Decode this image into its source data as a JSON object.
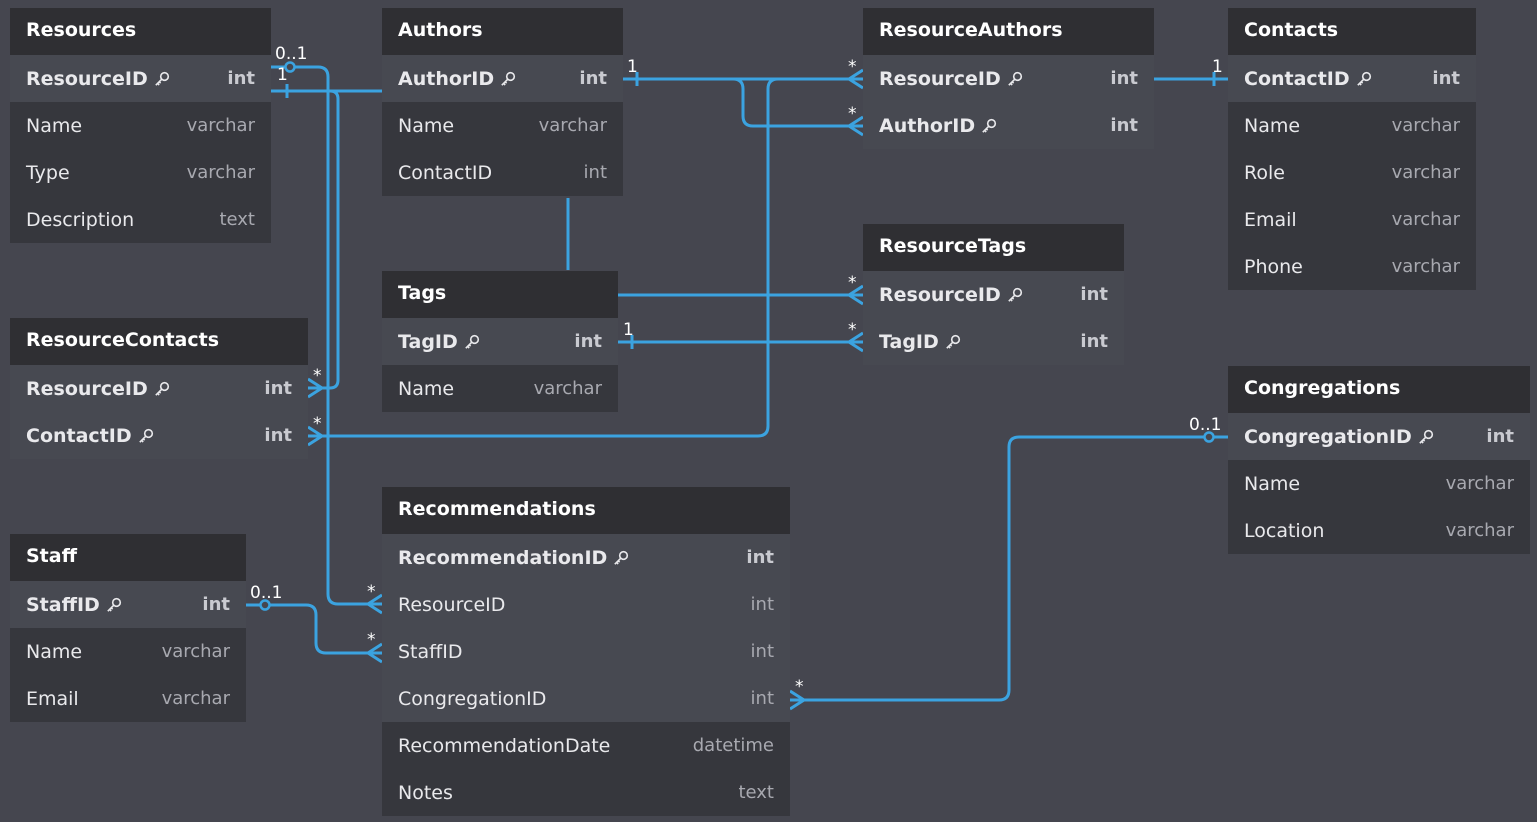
{
  "tables": [
    {
      "id": "resources",
      "title": "Resources",
      "fields": [
        {
          "name": "ResourceID",
          "type": "int",
          "pk": true
        },
        {
          "name": "Name",
          "type": "varchar"
        },
        {
          "name": "Type",
          "type": "varchar"
        },
        {
          "name": "Description",
          "type": "text"
        }
      ]
    },
    {
      "id": "authors",
      "title": "Authors",
      "fields": [
        {
          "name": "AuthorID",
          "type": "int",
          "pk": true
        },
        {
          "name": "Name",
          "type": "varchar"
        },
        {
          "name": "ContactID",
          "type": "int"
        }
      ]
    },
    {
      "id": "resourceauthors",
      "title": "ResourceAuthors",
      "fields": [
        {
          "name": "ResourceID",
          "type": "int",
          "pk": true
        },
        {
          "name": "AuthorID",
          "type": "int",
          "pk": true
        }
      ]
    },
    {
      "id": "contacts",
      "title": "Contacts",
      "fields": [
        {
          "name": "ContactID",
          "type": "int",
          "pk": true
        },
        {
          "name": "Name",
          "type": "varchar"
        },
        {
          "name": "Role",
          "type": "varchar"
        },
        {
          "name": "Email",
          "type": "varchar"
        },
        {
          "name": "Phone",
          "type": "varchar"
        }
      ]
    },
    {
      "id": "resourcetags",
      "title": "ResourceTags",
      "fields": [
        {
          "name": "ResourceID",
          "type": "int",
          "pk": true
        },
        {
          "name": "TagID",
          "type": "int",
          "pk": true
        }
      ]
    },
    {
      "id": "tags",
      "title": "Tags",
      "fields": [
        {
          "name": "TagID",
          "type": "int",
          "pk": true
        },
        {
          "name": "Name",
          "type": "varchar"
        }
      ]
    },
    {
      "id": "resourcecontacts",
      "title": "ResourceContacts",
      "fields": [
        {
          "name": "ResourceID",
          "type": "int",
          "pk": true
        },
        {
          "name": "ContactID",
          "type": "int",
          "pk": true
        }
      ]
    },
    {
      "id": "congregations",
      "title": "Congregations",
      "fields": [
        {
          "name": "CongregationID",
          "type": "int",
          "pk": true
        },
        {
          "name": "Name",
          "type": "varchar"
        },
        {
          "name": "Location",
          "type": "varchar"
        }
      ]
    },
    {
      "id": "staff",
      "title": "Staff",
      "fields": [
        {
          "name": "StaffID",
          "type": "int",
          "pk": true
        },
        {
          "name": "Name",
          "type": "varchar"
        },
        {
          "name": "Email",
          "type": "varchar"
        }
      ]
    },
    {
      "id": "recommendations",
      "title": "Recommendations",
      "fields": [
        {
          "name": "RecommendationID",
          "type": "int",
          "pk": true
        },
        {
          "name": "ResourceID",
          "type": "int",
          "fk": true
        },
        {
          "name": "StaffID",
          "type": "int",
          "fk": true
        },
        {
          "name": "CongregationID",
          "type": "int",
          "fk": true
        },
        {
          "name": "RecommendationDate",
          "type": "datetime"
        },
        {
          "name": "Notes",
          "type": "text"
        }
      ]
    }
  ],
  "cardinality_labels": {
    "res_zero_one": "0..1",
    "res_one": "1",
    "authors_one": "1",
    "ra_res_many": "*",
    "ra_auth_many": "*",
    "ra_contacts_one": "1",
    "rt_res_many": "*",
    "rt_tag_many": "*",
    "tags_one": "1",
    "rc_res_many": "*",
    "rc_contact_many": "*",
    "cong_zero_one": "0..1",
    "staff_zero_one": "0..1",
    "rec_res_many": "*",
    "rec_staff_many": "*",
    "rec_cong_many": "*"
  },
  "colors": {
    "background": "#45464f",
    "header": "#2f2f33",
    "key_row": "#474951",
    "row": "#36373d",
    "connector": "#3ba3e0"
  }
}
